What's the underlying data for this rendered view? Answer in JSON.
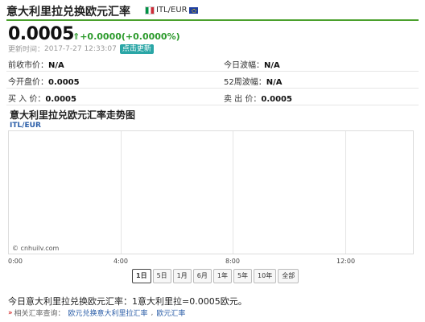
{
  "header": {
    "title": "意大利里拉兑换欧元汇率",
    "pair_code": "ITL/EUR"
  },
  "quote": {
    "price": "0.0005",
    "change": "+0.0000(+0.0000%)",
    "update_prefix": "更新时间：",
    "update_time": "2017-7-27 12:33:07",
    "refresh_label": "点击更新"
  },
  "info": {
    "rows": [
      {
        "left_label": "前收市价：",
        "left_value": "N/A",
        "right_label": "今日波幅：",
        "right_value": "N/A"
      },
      {
        "left_label": "今开盘价：",
        "left_value": "0.0005",
        "right_label": "52周波幅：",
        "right_value": "N/A"
      },
      {
        "left_label": "买 入 价：",
        "left_value": "0.0005",
        "right_label": "卖 出 价：",
        "right_value": "0.0005"
      }
    ]
  },
  "chart": {
    "title": "意大利里拉兑欧元汇率走势图",
    "pair_label": "ITL/EUR",
    "watermark": "© cnhuilv.com",
    "x_ticks": [
      "0:00",
      "4:00",
      "8:00",
      "12:00"
    ]
  },
  "range_buttons": [
    "1日",
    "5日",
    "1月",
    "6月",
    "1年",
    "5年",
    "10年",
    "全部"
  ],
  "summary": {
    "text": "今日意大利里拉兑换欧元汇率：1意大利里拉=0.0005欧元。"
  },
  "related": {
    "label": "相关汇率查询：",
    "links": [
      "欧元兑换意大利里拉汇率",
      "欧元汇率"
    ],
    "separator": ","
  },
  "colors": {
    "accent_green": "#4aa02c",
    "up_green": "#2b9a2b",
    "refresh_teal": "#2aa6a6",
    "link_blue": "#2b5ea8"
  }
}
